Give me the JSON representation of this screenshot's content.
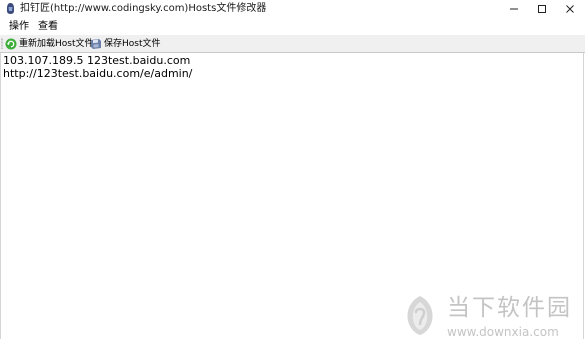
{
  "window": {
    "title": "扣钉匠(http://www.codingsky.com)Hosts文件修改器",
    "controls": {
      "minimize": "minimize-icon",
      "maximize": "maximize-icon",
      "close": "close-icon"
    }
  },
  "menubar": {
    "items": [
      {
        "label": "操作"
      },
      {
        "label": "查看"
      }
    ]
  },
  "toolbar": {
    "reload_label": "重新加载Host文件",
    "reload_icon": "refresh-icon",
    "save_label": "保存Host文件",
    "save_icon": "save-disk-icon"
  },
  "editor": {
    "lines": [
      "103.107.189.5 123test.baidu.com",
      "http://123test.baidu.com/e/admin/"
    ]
  },
  "watermark": {
    "brand": "当下软件园",
    "url": "www.downxia.com"
  },
  "colors": {
    "accent_green": "#3fae3a",
    "watermark_gray": "#c4c4c4",
    "toolbar_bg": "#f0f0f0"
  }
}
